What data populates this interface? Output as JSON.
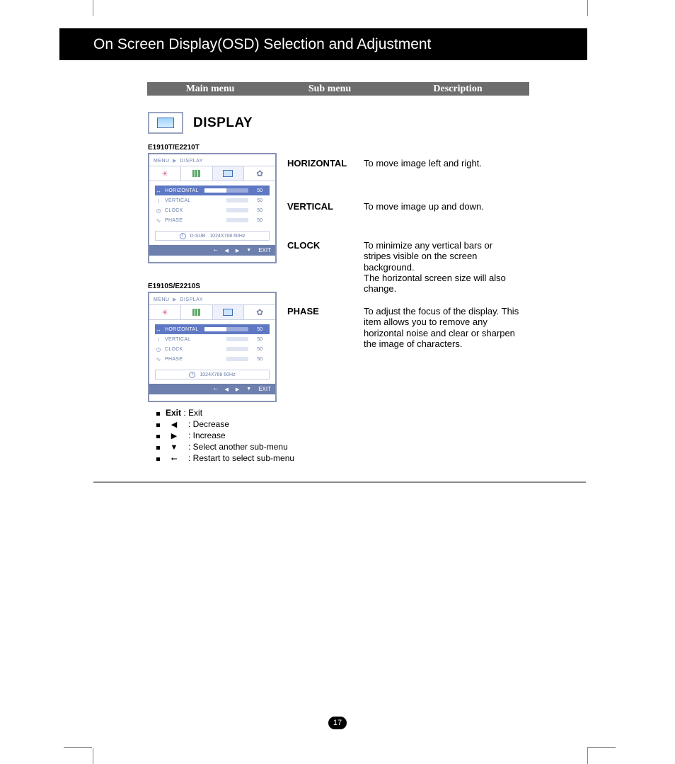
{
  "page": {
    "title": "On Screen Display(OSD) Selection and Adjustment",
    "number": "17"
  },
  "column_headers": {
    "main": "Main menu",
    "sub": "Sub menu",
    "desc": "Description"
  },
  "display": {
    "label": "DISPLAY"
  },
  "models": {
    "t": "E1910T/E2210T",
    "s": "E1910S/E2210S"
  },
  "osd": {
    "menu_label": "MENU",
    "section_label": "DISPLAY",
    "rows": [
      {
        "icon": "↔",
        "label": "HORIZONTAL",
        "value": "50"
      },
      {
        "icon": "↕",
        "label": "VERTICAL",
        "value": "50"
      },
      {
        "icon": "◷",
        "label": "CLOCK",
        "value": "50"
      },
      {
        "icon": "∿",
        "label": "PHASE",
        "value": "50"
      }
    ],
    "status": {
      "connector": "D-SUB",
      "mode": "1024X768  60Hz",
      "mode_s": "1024X768  60Hz"
    },
    "foot_exit": "EXIT"
  },
  "descriptions": [
    {
      "sub": "HORIZONTAL",
      "text": "To move image left and right."
    },
    {
      "sub": "VERTICAL",
      "text": "To move image up and down."
    },
    {
      "sub": "CLOCK",
      "text": "To minimize any vertical bars or stripes visible on the screen background.\nThe horizontal screen size will also change."
    },
    {
      "sub": "PHASE",
      "text": "To adjust the focus of the display. This item allows you to remove any horizontal noise and clear or sharpen the image of characters."
    }
  ],
  "legend": {
    "exit_label": "Exit",
    "exit_text": ": Exit",
    "decrease": ": Decrease",
    "increase": ": Increase",
    "select": ": Select another sub-menu",
    "restart": ": Restart to select sub-menu"
  }
}
